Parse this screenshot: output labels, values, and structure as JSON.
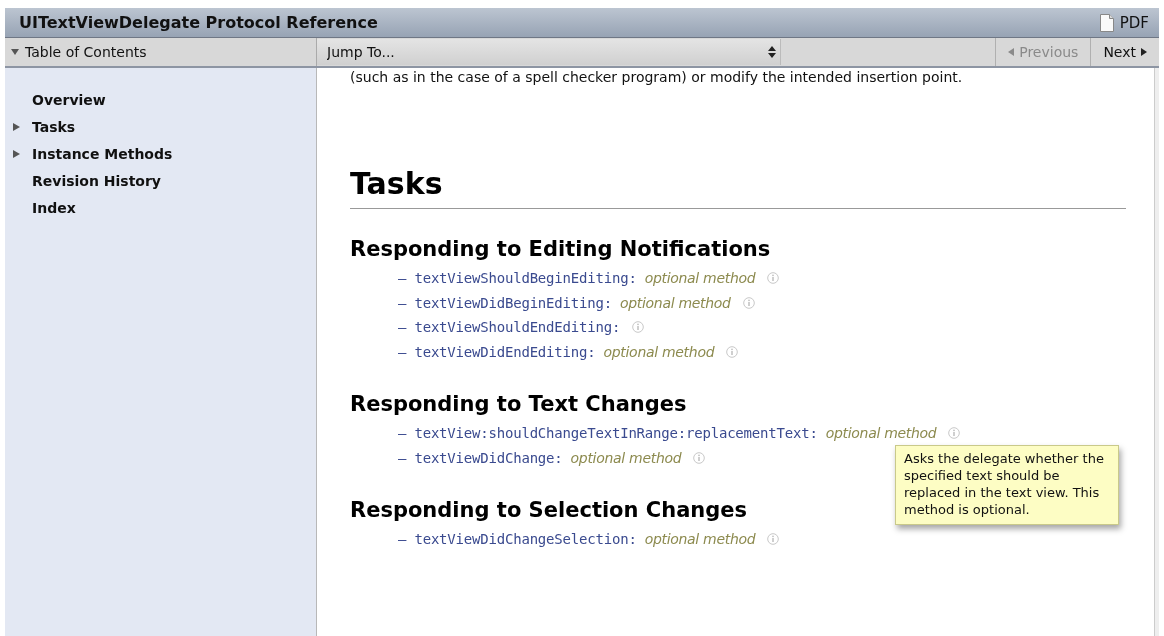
{
  "window": {
    "title": "UITextViewDelegate Protocol Reference",
    "pdf_label": "PDF"
  },
  "toolbar": {
    "toc_label": "Table of Contents",
    "toc_expanded": true,
    "jump_placeholder": "Jump To...",
    "previous": {
      "label": "Previous",
      "disabled": true
    },
    "next": {
      "label": "Next",
      "disabled": false
    }
  },
  "sidebar": {
    "items": [
      {
        "label": "Overview"
      },
      {
        "label": "Tasks",
        "expanded": false
      },
      {
        "label": "Instance Methods",
        "expanded": false
      },
      {
        "label": "Revision History"
      },
      {
        "label": "Index"
      }
    ]
  },
  "content": {
    "intro_fragment": "(such as in the case of a spell checker program) or modify the intended insertion point.",
    "heading": "Tasks",
    "sections": [
      {
        "title": "Responding to Editing Notifications",
        "methods": [
          {
            "bullet": "–",
            "name": "textViewShouldBeginEditing:",
            "note": "optional method"
          },
          {
            "bullet": "–",
            "name": "textViewDidBeginEditing:",
            "note": "optional method"
          },
          {
            "bullet": "–",
            "name": "textViewShouldEndEditing:"
          },
          {
            "bullet": "–",
            "name": "textViewDidEndEditing:",
            "note": "optional method"
          }
        ]
      },
      {
        "title": "Responding to Text Changes",
        "methods": [
          {
            "bullet": "–",
            "name": "textView:shouldChangeTextInRange:replacementText:",
            "note": "optional method",
            "tooltip": "Asks the delegate whether the specified text should be replaced in the text view. This method is optional."
          },
          {
            "bullet": "–",
            "name": "textViewDidChange:",
            "note": "optional method"
          }
        ]
      },
      {
        "title": "Responding to Selection Changes",
        "methods": [
          {
            "bullet": "–",
            "name": "textViewDidChangeSelection:",
            "note": "optional method"
          }
        ]
      }
    ]
  }
}
